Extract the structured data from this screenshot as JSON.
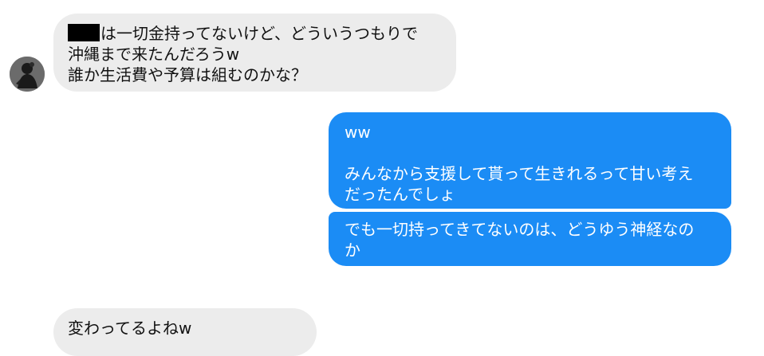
{
  "conversation": {
    "incoming_avatar": {
      "icon": "user-avatar-icon"
    },
    "messages": [
      {
        "direction": "incoming",
        "redacted_prefix": true,
        "text": "は一切金持ってないけど、どういうつもりで\n沖縄まで来たんだろうw\n誰か生活費や予算は組むのかな？"
      },
      {
        "direction": "outgoing",
        "text": "ww\n\nみんなから支援して貰って生きれるって甘い考え\nだったんでしょ"
      },
      {
        "direction": "outgoing",
        "text": "でも一切持ってきてないのは、どうゆう神経なの\nか"
      },
      {
        "direction": "incoming",
        "text": "変わってるよねw"
      }
    ]
  },
  "colors": {
    "incoming_bubble": "#ececec",
    "outgoing_bubble": "#1b8cf5",
    "incoming_text": "#111111",
    "outgoing_text": "#ffffff",
    "redaction": "#000000"
  }
}
